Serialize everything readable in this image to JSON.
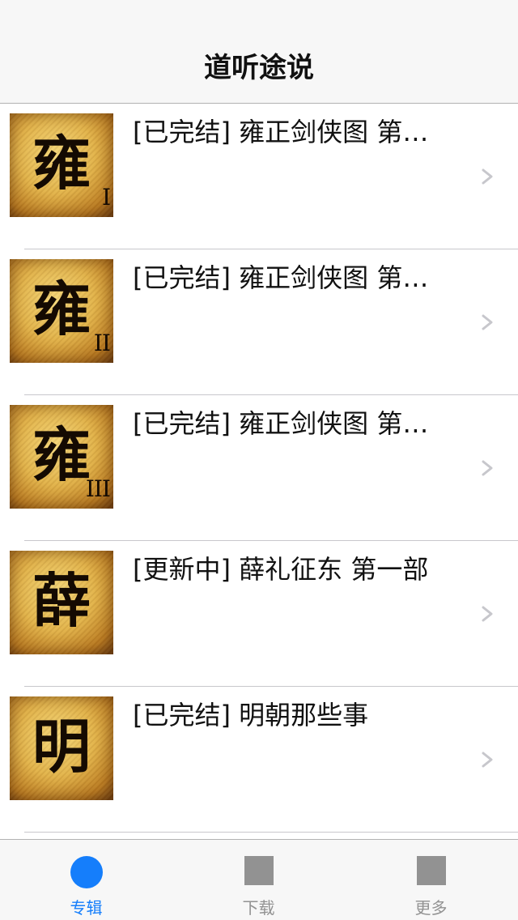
{
  "nav": {
    "title": "道听途说"
  },
  "albums": [
    {
      "title": "[已完结] 雍正剑侠图 第…",
      "cover_char": "雍",
      "cover_numeral": "I"
    },
    {
      "title": "[已完结] 雍正剑侠图 第…",
      "cover_char": "雍",
      "cover_numeral": "II"
    },
    {
      "title": "[已完结] 雍正剑侠图 第…",
      "cover_char": "雍",
      "cover_numeral": "III"
    },
    {
      "title": "[更新中] 薛礼征东 第一部",
      "cover_char": "薛",
      "cover_numeral": ""
    },
    {
      "title": "[已完结] 明朝那些事",
      "cover_char": "明",
      "cover_numeral": ""
    }
  ],
  "tabs": [
    {
      "label": "专辑",
      "icon": "album-tab-icon",
      "active": true
    },
    {
      "label": "下载",
      "icon": "download-tab-icon",
      "active": false
    },
    {
      "label": "更多",
      "icon": "more-tab-icon",
      "active": false
    }
  ],
  "colors": {
    "accent": "#157efb",
    "inactive": "#929292",
    "bar_background": "#f7f7f7",
    "separator": "#c8c7cc",
    "chevron": "#c7c7cc"
  }
}
